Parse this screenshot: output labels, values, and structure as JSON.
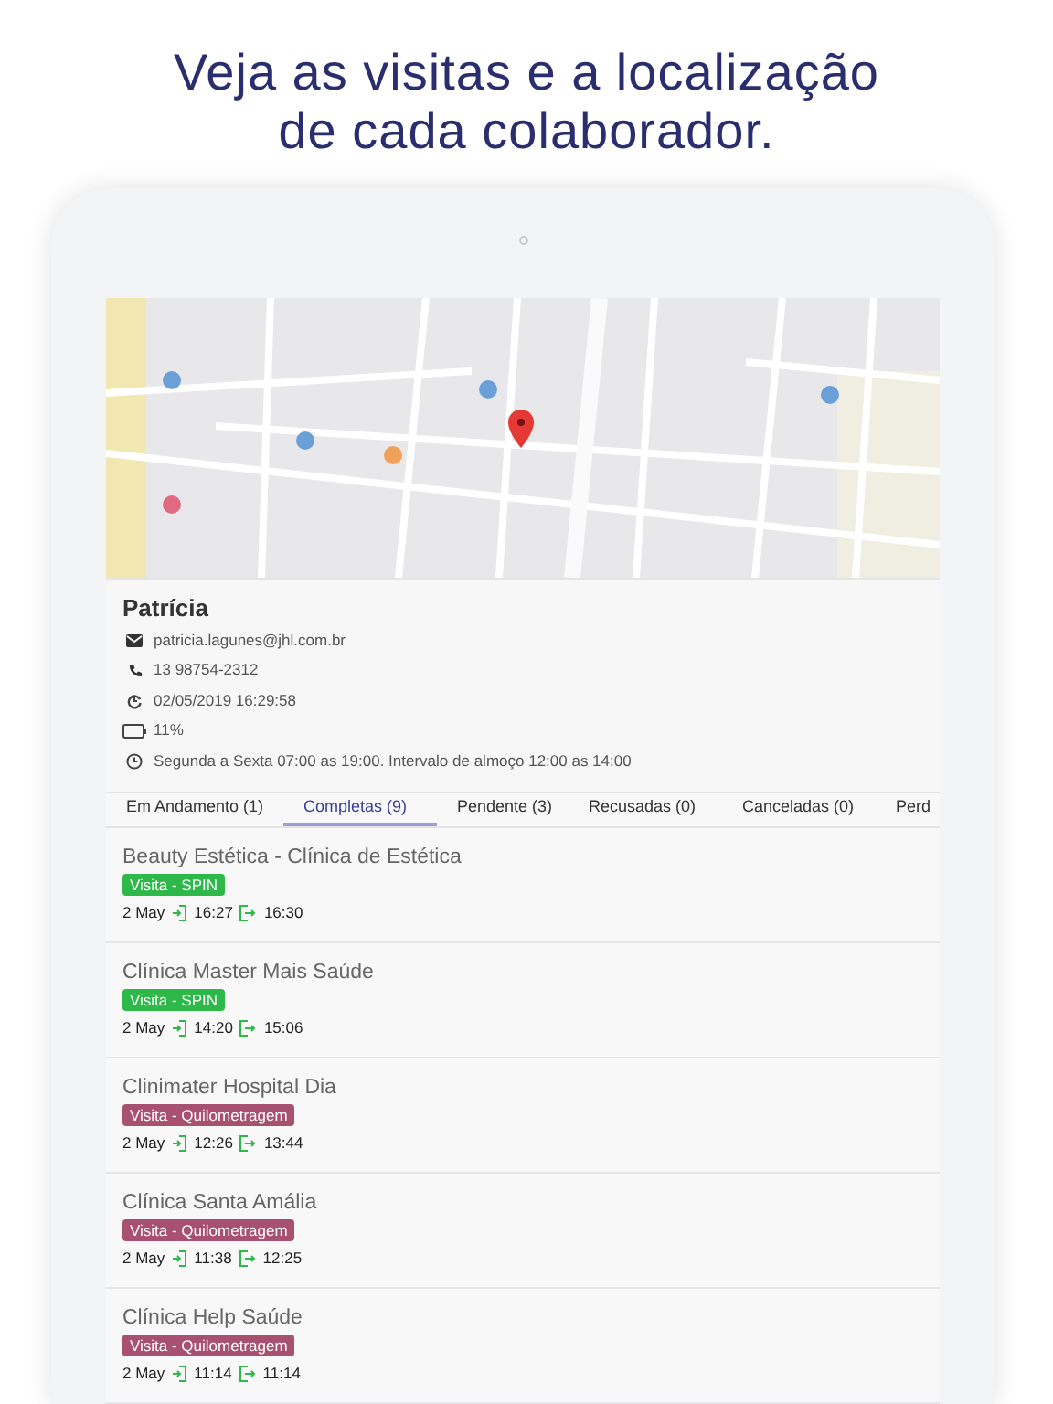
{
  "headline": [
    "Veja as visitas e a localização",
    "de cada colaborador."
  ],
  "profile": {
    "name": "Patrícia",
    "details": [
      {
        "kind": "email",
        "text": "patricia.lagunes@jhl.com.br"
      },
      {
        "kind": "phone",
        "text": "13 98754-2312"
      },
      {
        "kind": "updated",
        "text": "02/05/2019 16:29:58"
      },
      {
        "kind": "battery",
        "text": "11%"
      },
      {
        "kind": "schedule",
        "text": "Segunda a Sexta 07:00 as 19:00. Intervalo de almoço 12:00 as 14:00"
      }
    ]
  },
  "tabs": [
    {
      "label": "Em Andamento (1)",
      "selected": false
    },
    {
      "label": "Completas (9)",
      "selected": true
    },
    {
      "label": "Pendente (3)",
      "selected": false
    },
    {
      "label": "Recusadas (0)",
      "selected": false
    },
    {
      "label": "Canceladas (0)",
      "selected": false
    },
    {
      "label": "Perd",
      "selected": false
    }
  ],
  "visits": [
    {
      "title": "Beauty Estética - Clínica de Estética",
      "tag": {
        "label": "Visita - SPIN",
        "color": "#2eb84a"
      },
      "date": "2 May",
      "check_in": "16:27",
      "check_out": "16:30"
    },
    {
      "title": "Clínica Master Mais Saúde",
      "tag": {
        "label": "Visita - SPIN",
        "color": "#2eb84a"
      },
      "date": "2 May",
      "check_in": "14:20",
      "check_out": "15:06"
    },
    {
      "title": "Clinimater Hospital Dia",
      "tag": {
        "label": "Visita - Quilometragem",
        "color": "#a8506f"
      },
      "date": "2 May",
      "check_in": "12:26",
      "check_out": "13:44"
    },
    {
      "title": "Clínica Santa Amália",
      "tag": {
        "label": "Visita - Quilometragem",
        "color": "#a8506f"
      },
      "date": "2 May",
      "check_in": "11:38",
      "check_out": "12:25"
    },
    {
      "title": "Clínica Help Saúde",
      "tag": {
        "label": "Visita - Quilometragem",
        "color": "#a8506f"
      },
      "date": "2 May",
      "check_in": "11:14",
      "check_out": "11:14"
    }
  ]
}
